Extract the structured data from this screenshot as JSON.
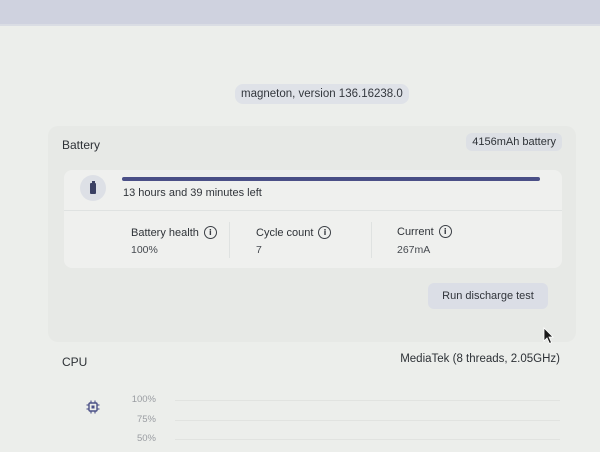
{
  "version": "magneton, version 136.16238.0",
  "battery": {
    "title": "Battery",
    "capacity": "4156mAh battery",
    "time_left": "13 hours and 39 minutes left",
    "charge_fraction": 1.0,
    "stats": [
      {
        "label": "Battery health",
        "value": "100%"
      },
      {
        "label": "Cycle count",
        "value": "7"
      },
      {
        "label": "Current",
        "value": "267mA"
      }
    ],
    "discharge_button": "Run discharge test"
  },
  "cpu": {
    "title": "CPU",
    "info": "MediaTek (8 threads, 2.05GHz)",
    "axis": [
      "100%",
      "75%",
      "50%"
    ]
  },
  "colors": {
    "accent": "#4b5087",
    "background": "#eceeeb"
  }
}
